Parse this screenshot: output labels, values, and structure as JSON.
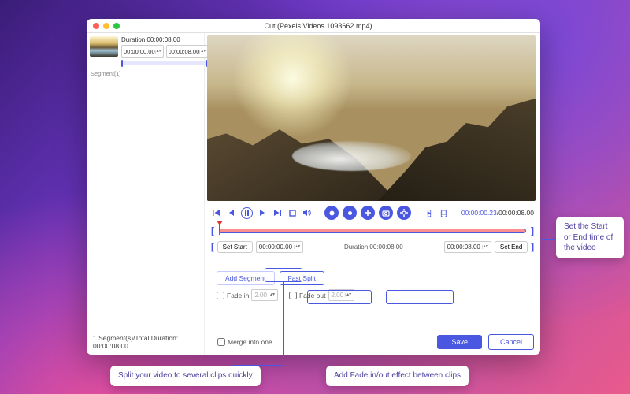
{
  "window": {
    "title": "Cut (Pexels Videos 1093662.mp4)"
  },
  "sidebar": {
    "duration_label": "Duration:00:00:08.00",
    "start_value": "00:00:00.00",
    "end_value": "00:00:08.00",
    "segment_tag": "Segment[1]"
  },
  "controls": {
    "timecode_current": "00:00:00.23",
    "timecode_total": "/00:00:08.00"
  },
  "range": {
    "set_start_label": "Set Start",
    "start_value": "00:00:00.00",
    "duration_label": "Duration:00:00:08.00",
    "end_value": "00:00:08.00",
    "set_end_label": "Set End"
  },
  "actions": {
    "add_segment": "Add Segment",
    "fast_split": "Fast Split"
  },
  "fade": {
    "fade_in_label": "Fade in",
    "fade_in_value": "2.00",
    "fade_out_label": "Fade out",
    "fade_out_value": "2.00"
  },
  "bottom": {
    "summary": "1 Segment(s)/Total Duration: 00:00:08.00",
    "merge_label": "Merge into one",
    "save": "Save",
    "cancel": "Cancel"
  },
  "callouts": {
    "right": "Set the Start or End time of the video",
    "left": "Split your video to several clips quickly",
    "mid": "Add Fade in/out effect between clips"
  }
}
